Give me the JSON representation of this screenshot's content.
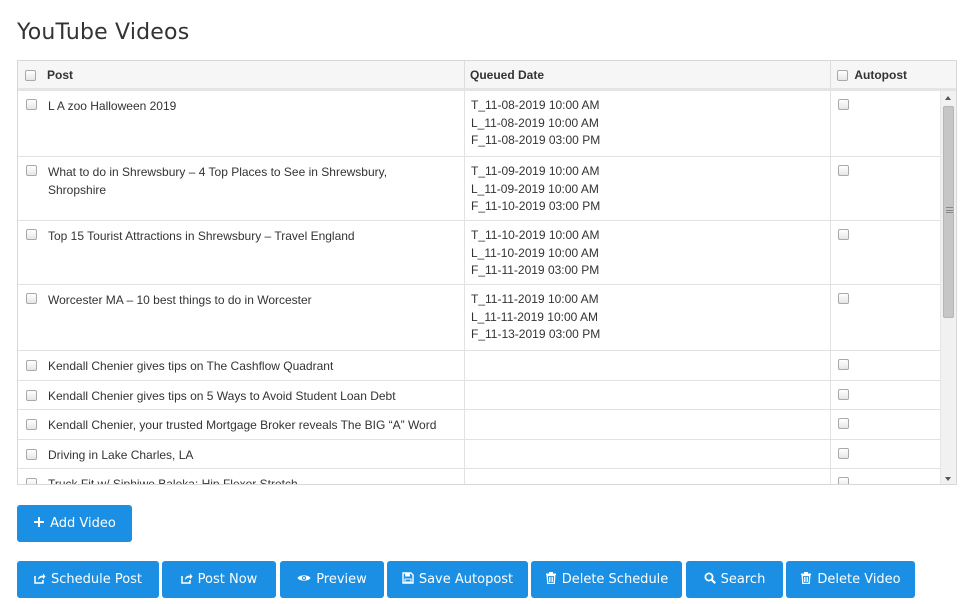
{
  "page": {
    "title": "YouTube Videos"
  },
  "table": {
    "columns": {
      "post": "Post",
      "queued_date": "Queued Date",
      "autopost": "Autopost"
    },
    "rows": [
      {
        "post": [
          "L A zoo Halloween 2019"
        ],
        "dates": [
          "T_11-08-2019 10:00 AM",
          "L_11-08-2019 10:00 AM",
          "F_11-08-2019 03:00 PM"
        ]
      },
      {
        "post": [
          "What to do in Shrewsbury – 4 Top Places to See in Shrewsbury,",
          "Shropshire"
        ],
        "dates": [
          "T_11-09-2019 10:00 AM",
          "L_11-09-2019 10:00 AM",
          "F_11-10-2019 03:00 PM"
        ]
      },
      {
        "post": [
          "Top 15 Tourist Attractions in Shrewsbury – Travel England"
        ],
        "dates": [
          "T_11-10-2019 10:00 AM",
          "L_11-10-2019 10:00 AM",
          "F_11-11-2019 03:00 PM"
        ]
      },
      {
        "post": [
          "Worcester MA – 10 best things to do in Worcester"
        ],
        "dates": [
          "T_11-11-2019 10:00 AM",
          "L_11-11-2019 10:00 AM",
          "F_11-13-2019 03:00 PM"
        ]
      },
      {
        "post": [
          "Kendall Chenier gives tips on The Cashflow Quadrant"
        ],
        "dates": []
      },
      {
        "post": [
          "Kendall Chenier gives tips on 5 Ways to Avoid Student Loan Debt"
        ],
        "dates": []
      },
      {
        "post": [
          "Kendall Chenier, your trusted Mortgage Broker reveals The BIG “A” Word"
        ],
        "dates": []
      },
      {
        "post": [
          "Driving in Lake Charles, LA"
        ],
        "dates": []
      },
      {
        "post": [
          "Truck Fit w/ Siphiwe Baleka: Hip Flexor Stretch"
        ],
        "dates": []
      }
    ]
  },
  "buttons": {
    "add_video": {
      "label": "Add Video",
      "icon": "plus-icon"
    },
    "actions": [
      {
        "label": "Schedule Post",
        "icon": "share-icon",
        "name": "schedule-post-button"
      },
      {
        "label": "Post Now",
        "icon": "share-icon",
        "name": "post-now-button"
      },
      {
        "label": "Preview",
        "icon": "eye-icon",
        "name": "preview-button"
      },
      {
        "label": "Save Autopost",
        "icon": "save-icon",
        "name": "save-autopost-button"
      },
      {
        "label": "Delete Schedule",
        "icon": "trash-icon",
        "name": "delete-schedule-button"
      },
      {
        "label": "Search",
        "icon": "search-icon",
        "name": "search-button"
      },
      {
        "label": "Delete Video",
        "icon": "trash-icon",
        "name": "delete-video-button"
      }
    ]
  },
  "colors": {
    "primary_button": "#1a8fe3",
    "header_bg": "#f6f6f6"
  }
}
